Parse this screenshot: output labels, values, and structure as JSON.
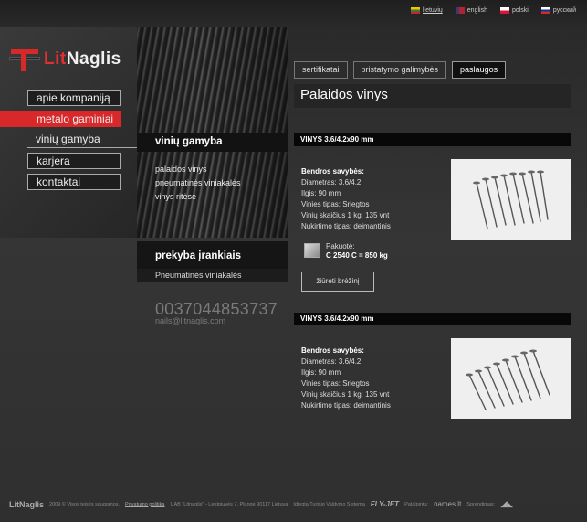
{
  "languages": [
    {
      "label": "lietuvių",
      "colors": [
        "#f5c400",
        "#1e8a3c",
        "#c1272d"
      ],
      "active": true
    },
    {
      "label": "english",
      "colors": [
        "#b22234",
        "#ffffff",
        "#3c3b6e"
      ],
      "active": false
    },
    {
      "label": "polski",
      "colors": [
        "#ffffff",
        "#ffffff",
        "#dc143c"
      ],
      "active": false
    },
    {
      "label": "русский",
      "colors": [
        "#ffffff",
        "#0039a6",
        "#d52b1e"
      ],
      "active": false
    }
  ],
  "logo": {
    "part1": "Lit",
    "part2": "Naglis"
  },
  "nav": [
    {
      "label": "apie kompaniją",
      "state": "normal"
    },
    {
      "label": "metalo gaminiai",
      "state": "active"
    },
    {
      "label": "vinių gamyba",
      "state": "open"
    },
    {
      "label": "karjera",
      "state": "normal"
    },
    {
      "label": "kontaktai",
      "state": "normal"
    }
  ],
  "submenu": {
    "title": "vinių gamyba",
    "items": [
      "palaidos vinys",
      "pneumatinės viniakalės",
      "vinys ritėse"
    ]
  },
  "tools": {
    "title": "prekyba įrankiais",
    "items": [
      "Pneumatinės viniakalės"
    ]
  },
  "contact": {
    "phone": "0037044853737",
    "email": "nails@litnaglis.com"
  },
  "tabs": [
    {
      "label": "sertifikatai",
      "active": false
    },
    {
      "label": "pristatymo galimybės",
      "active": false
    },
    {
      "label": "paslaugos",
      "active": true
    }
  ],
  "page_title": "Palaidos vinys",
  "products": [
    {
      "heading": "VINYS 3.6/4.2x90 mm",
      "specs_title": "Bendros savybės:",
      "specs": [
        "Diametras: 3.6/4.2",
        "Ilgis: 90 mm",
        "Vinies tipas: Sriegtos",
        "Vinių skaičius 1 kg: 135 vnt",
        "Nukirtimo tipas: deimantinis"
      ],
      "pack_label": "Pakuotė:",
      "pack_value": "C 2540 C = 850 kg",
      "button": "žiūrėti brėžinį"
    },
    {
      "heading": "VINYS 3.6/4.2x90 mm",
      "specs_title": "Bendros savybės:",
      "specs": [
        "Diametras: 3.6/4.2",
        "Ilgis: 90 mm",
        "Vinies tipas: Sriegtos",
        "Vinių skaičius 1 kg: 135 vnt",
        "Nukirtimo tipas: deimantinis"
      ]
    }
  ],
  "footer": {
    "logo": "LitNaglis",
    "copyright": "2009 © Visos teisės saugomos.",
    "privacy": "Privatumo politika",
    "company": "UAB \"Litnaglis\" - Lentpjuvės 7, Plungė 90117 Lietuva",
    "cms": "Įdiegta Turinio Valdymo Sistema",
    "cms_brand": "FLY-JET",
    "made_by": "Patalpinta:",
    "made_brand": "names.lt",
    "design": "Sprendimas:"
  }
}
